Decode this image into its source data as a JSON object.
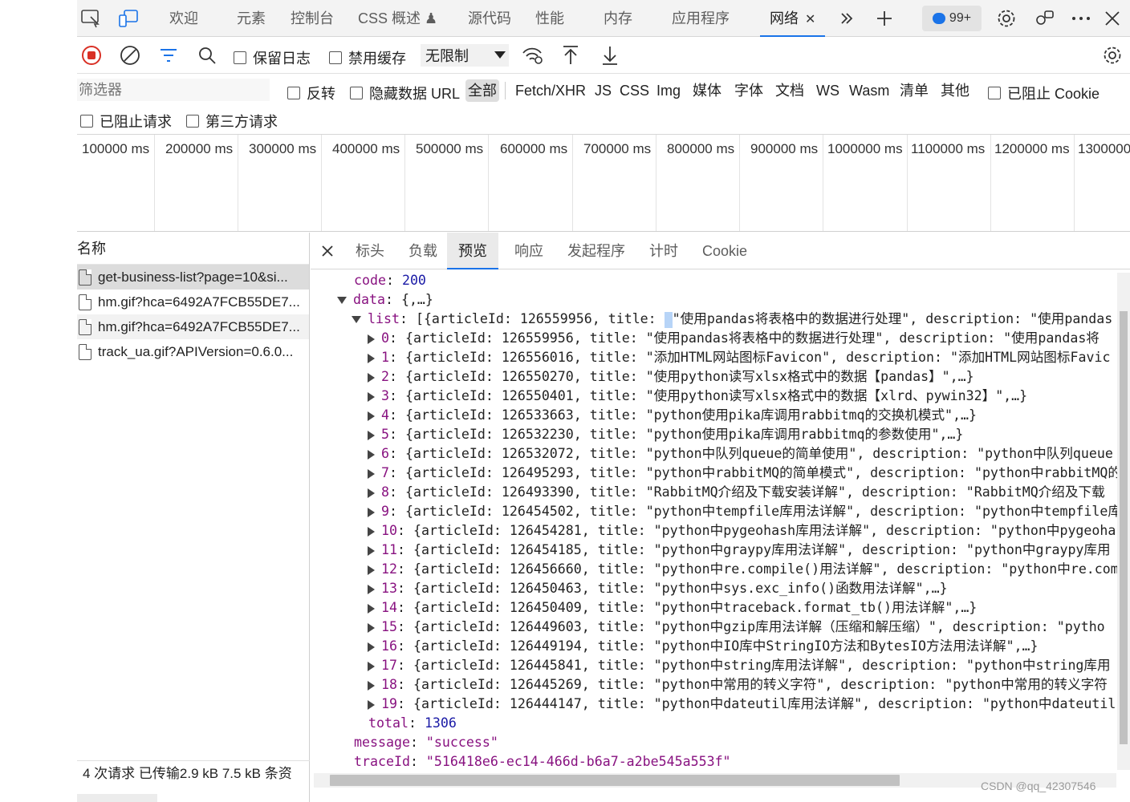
{
  "top_tabs": [
    {
      "label": "欢迎"
    },
    {
      "label": "元素"
    },
    {
      "label": "控制台"
    },
    {
      "label": "CSS 概述 ♟"
    },
    {
      "label": "源代码"
    },
    {
      "label": "性能"
    },
    {
      "label": "内存"
    },
    {
      "label": "应用程序"
    },
    {
      "label": "网络"
    }
  ],
  "issues_badge": "99+",
  "toolbar": {
    "preserve_log": "保留日志",
    "disable_cache": "禁用缓存",
    "throttle": "无限制"
  },
  "filter": {
    "placeholder": "筛选器",
    "invert": "反转",
    "hide_data_urls": "隐藏数据 URL",
    "types": [
      "全部",
      "Fetch/XHR",
      "JS",
      "CSS",
      "Img",
      "媒体",
      "字体",
      "文档",
      "WS",
      "Wasm",
      "清单",
      "其他"
    ],
    "blocked_cookies": "已阻止 Cookie",
    "blocked_requests": "已阻止请求",
    "third_party": "第三方请求"
  },
  "timeline_ticks": [
    "100000 ms",
    "200000 ms",
    "300000 ms",
    "400000 ms",
    "500000 ms",
    "600000 ms",
    "700000 ms",
    "800000 ms",
    "900000 ms",
    "1000000 ms",
    "1100000 ms",
    "1200000 ms",
    "1300000"
  ],
  "requests": {
    "header": "名称",
    "items": [
      {
        "name": "get-business-list?page=10&si..."
      },
      {
        "name": "hm.gif?hca=6492A7FCB55DE7..."
      },
      {
        "name": "hm.gif?hca=6492A7FCB55DE7..."
      },
      {
        "name": "track_ua.gif?APIVersion=0.6.0..."
      }
    ],
    "summary": "4 次请求  已传输2.9 kB  7.5 kB 条资"
  },
  "detail_tabs": [
    "标头",
    "负载",
    "预览",
    "响应",
    "发起程序",
    "计时",
    "Cookie"
  ],
  "preview": {
    "code_key": "code",
    "code_val": "200",
    "data_key": "data",
    "data_val": "{,…}",
    "list_key": "list",
    "list_head_a": "[{articleId: 126559956, title: ",
    "list_head_b": "\"使用pandas将表格中的数据进行处理\", description: \"使用pandas",
    "list_items": [
      {
        "idx": "0",
        "text": "{articleId: 126559956, title: \"使用pandas将表格中的数据进行处理\", description: \"使用pandas将"
      },
      {
        "idx": "1",
        "text": "{articleId: 126556016, title: \"添加HTML网站图标Favicon\", description: \"添加HTML网站图标Favic"
      },
      {
        "idx": "2",
        "text": "{articleId: 126550270, title: \"使用python读写xlsx格式中的数据【pandas】\",…}"
      },
      {
        "idx": "3",
        "text": "{articleId: 126550401, title: \"使用python读写xlsx格式中的数据【xlrd、pywin32】\",…}"
      },
      {
        "idx": "4",
        "text": "{articleId: 126533663, title: \"python使用pika库调用rabbitmq的交换机模式\",…}"
      },
      {
        "idx": "5",
        "text": "{articleId: 126532230, title: \"python使用pika库调用rabbitmq的参数使用\",…}"
      },
      {
        "idx": "6",
        "text": "{articleId: 126532072, title: \"python中队列queue的简单使用\", description: \"python中队列queue"
      },
      {
        "idx": "7",
        "text": "{articleId: 126495293, title: \"python中rabbitMQ的简单模式\", description: \"python中rabbitMQ的"
      },
      {
        "idx": "8",
        "text": "{articleId: 126493390, title: \"RabbitMQ介绍及下载安装详解\", description: \"RabbitMQ介绍及下载"
      },
      {
        "idx": "9",
        "text": "{articleId: 126454502, title: \"python中tempfile库用法详解\", description: \"python中tempfile库"
      },
      {
        "idx": "10",
        "text": "{articleId: 126454281, title: \"python中pygeohash库用法详解\", description: \"python中pygeoha"
      },
      {
        "idx": "11",
        "text": "{articleId: 126454185, title: \"python中graypy库用法详解\", description: \"python中graypy库用"
      },
      {
        "idx": "12",
        "text": "{articleId: 126456660, title: \"python中re.compile()用法详解\", description: \"python中re.com"
      },
      {
        "idx": "13",
        "text": "{articleId: 126450463, title: \"python中sys.exc_info()函数用法详解\",…}"
      },
      {
        "idx": "14",
        "text": "{articleId: 126450409, title: \"python中traceback.format_tb()用法详解\",…}"
      },
      {
        "idx": "15",
        "text": "{articleId: 126449603, title: \"python中gzip库用法详解（压缩和解压缩）\", description: \"pytho"
      },
      {
        "idx": "16",
        "text": "{articleId: 126449194, title: \"python中IO库中StringIO方法和BytesIO方法用法详解\",…}"
      },
      {
        "idx": "17",
        "text": "{articleId: 126445841, title: \"python中string库用法详解\", description: \"python中string库用"
      },
      {
        "idx": "18",
        "text": "{articleId: 126445269, title: \"python中常用的转义字符\", description: \"python中常用的转义字符"
      },
      {
        "idx": "19",
        "text": "{articleId: 126444147, title: \"python中dateutil库用法详解\", description: \"python中dateutil"
      }
    ],
    "total_key": "total",
    "total_val": "1306",
    "message_key": "message",
    "message_val": "\"success\"",
    "trace_key": "traceId",
    "trace_val": "\"516418e6-ec14-466d-b6a7-a2be545a553f\""
  },
  "watermark": "CSDN @qq_42307546",
  "colors": {
    "accent": "#1a73e8",
    "record": "#d93025",
    "json_key": "#881280",
    "json_number": "#1a1aa6"
  }
}
